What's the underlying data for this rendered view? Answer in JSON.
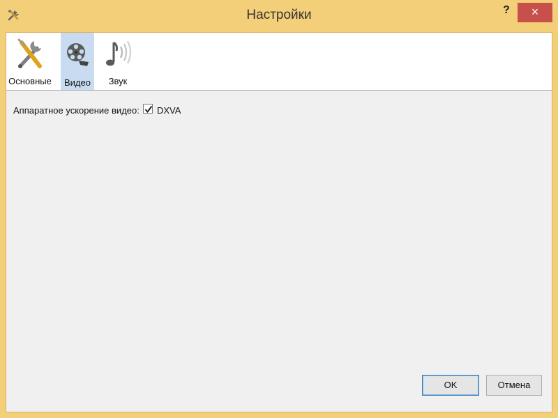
{
  "window": {
    "title": "Настройки",
    "help_label": "?",
    "close_label": "×"
  },
  "toolbar": {
    "items": [
      {
        "label": "Основные",
        "icon": "tools-icon",
        "selected": false
      },
      {
        "label": "Видео",
        "icon": "film-reel-icon",
        "selected": true
      },
      {
        "label": "Звук",
        "icon": "music-note-icon",
        "selected": false
      }
    ]
  },
  "video": {
    "hw_accel_label": "Аппаратное ускорение видео:",
    "dxva_label": "DXVA",
    "dxva_checked": true
  },
  "buttons": {
    "ok_label": "OK",
    "cancel_label": "Отмена"
  },
  "colors": {
    "title_bar": "#f4cf79",
    "close_button": "#c7504a",
    "selected_tab": "#c9dbf1",
    "client_background": "#f0f0f0"
  }
}
